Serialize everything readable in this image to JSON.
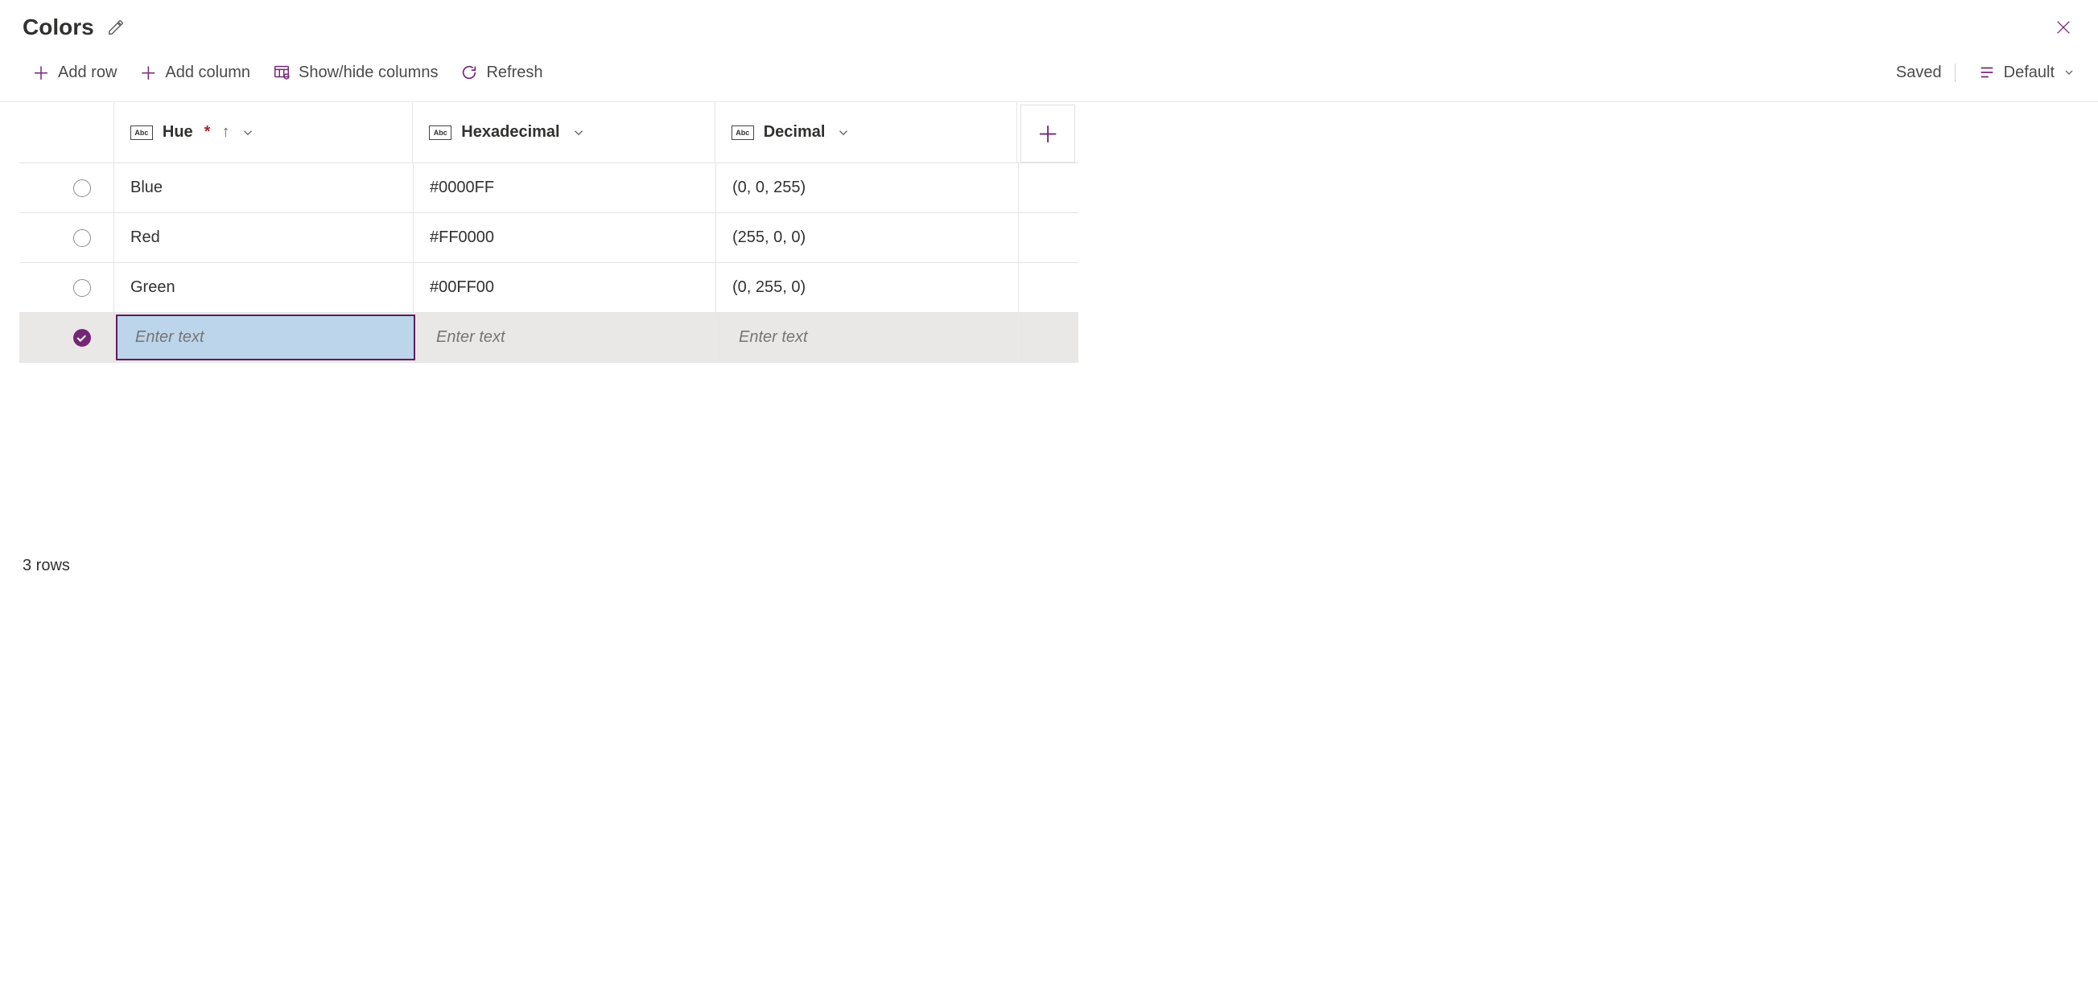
{
  "header": {
    "title": "Colors"
  },
  "toolbar": {
    "add_row": "Add row",
    "add_column": "Add column",
    "show_hide": "Show/hide columns",
    "refresh": "Refresh",
    "saved": "Saved",
    "view_name": "Default"
  },
  "columns": {
    "abc_tag": "Abc",
    "hue": "Hue",
    "hue_required": "*",
    "hue_sort": "↑",
    "hex": "Hexadecimal",
    "dec": "Decimal"
  },
  "rows": [
    {
      "hue": "Blue",
      "hex": "#0000FF",
      "dec": "(0, 0, 255)",
      "selected": false
    },
    {
      "hue": "Red",
      "hex": "#FF0000",
      "dec": "(255, 0, 0)",
      "selected": false
    },
    {
      "hue": "Green",
      "hex": "#00FF00",
      "dec": "(0, 255, 0)",
      "selected": false
    }
  ],
  "new_row": {
    "placeholder": "Enter text"
  },
  "footer": {
    "row_count": "3 rows"
  }
}
